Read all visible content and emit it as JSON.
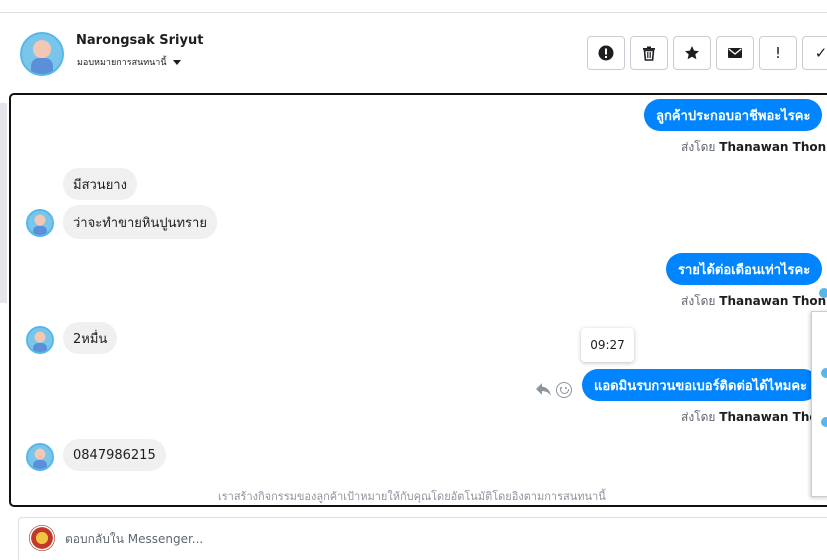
{
  "header": {
    "contact_name": "Narongsak Sriyut",
    "assign_label": "มอบหมายการสนทนานี้",
    "actions": [
      {
        "name": "spam-button",
        "icon": "alert-circle-icon",
        "glyph": "!"
      },
      {
        "name": "delete-button",
        "icon": "trash-icon",
        "glyph": ""
      },
      {
        "name": "star-button",
        "icon": "star-icon",
        "glyph": "★"
      },
      {
        "name": "mail-button",
        "icon": "envelope-icon",
        "glyph": "✉"
      },
      {
        "name": "mark-unread-button",
        "icon": "exclamation-icon",
        "glyph": "!"
      },
      {
        "name": "done-button",
        "icon": "check-icon",
        "glyph": "✓"
      }
    ]
  },
  "conversation": {
    "messages": [
      {
        "direction": "out",
        "text": "ลูกค้าประกอบอาชีพอะไรคะ"
      },
      {
        "direction": "in",
        "text": "มีสวนยาง"
      },
      {
        "direction": "in",
        "text": "ว่าจะทำขายหินปูนทราย"
      },
      {
        "direction": "out",
        "text": "รายได้ต่อเดือนเท่าไรคะ"
      },
      {
        "direction": "in",
        "text": "2หมื่น"
      },
      {
        "direction": "out",
        "text": "แอดมินรบกวนขอเบอร์ติดต่อได้ไหมคะ"
      },
      {
        "direction": "in",
        "text": "0847986215"
      }
    ],
    "sent_by_prefix": "ส่งโดย",
    "sent_by_name": "Thanawan Thon",
    "tooltip_time": "09:27",
    "footer_note": "เราสร้างกิจกรรมของลูกค้าเป้าหมายให้กับคุณโดยอัตโนมัติโดยอิงตามการสนทนานี้"
  },
  "reply": {
    "placeholder": "ตอบกลับใน Messenger..."
  },
  "colors": {
    "outgoing_bubble": "#0084ff",
    "incoming_bubble": "#f0f0f0",
    "frame_border": "#111111"
  }
}
